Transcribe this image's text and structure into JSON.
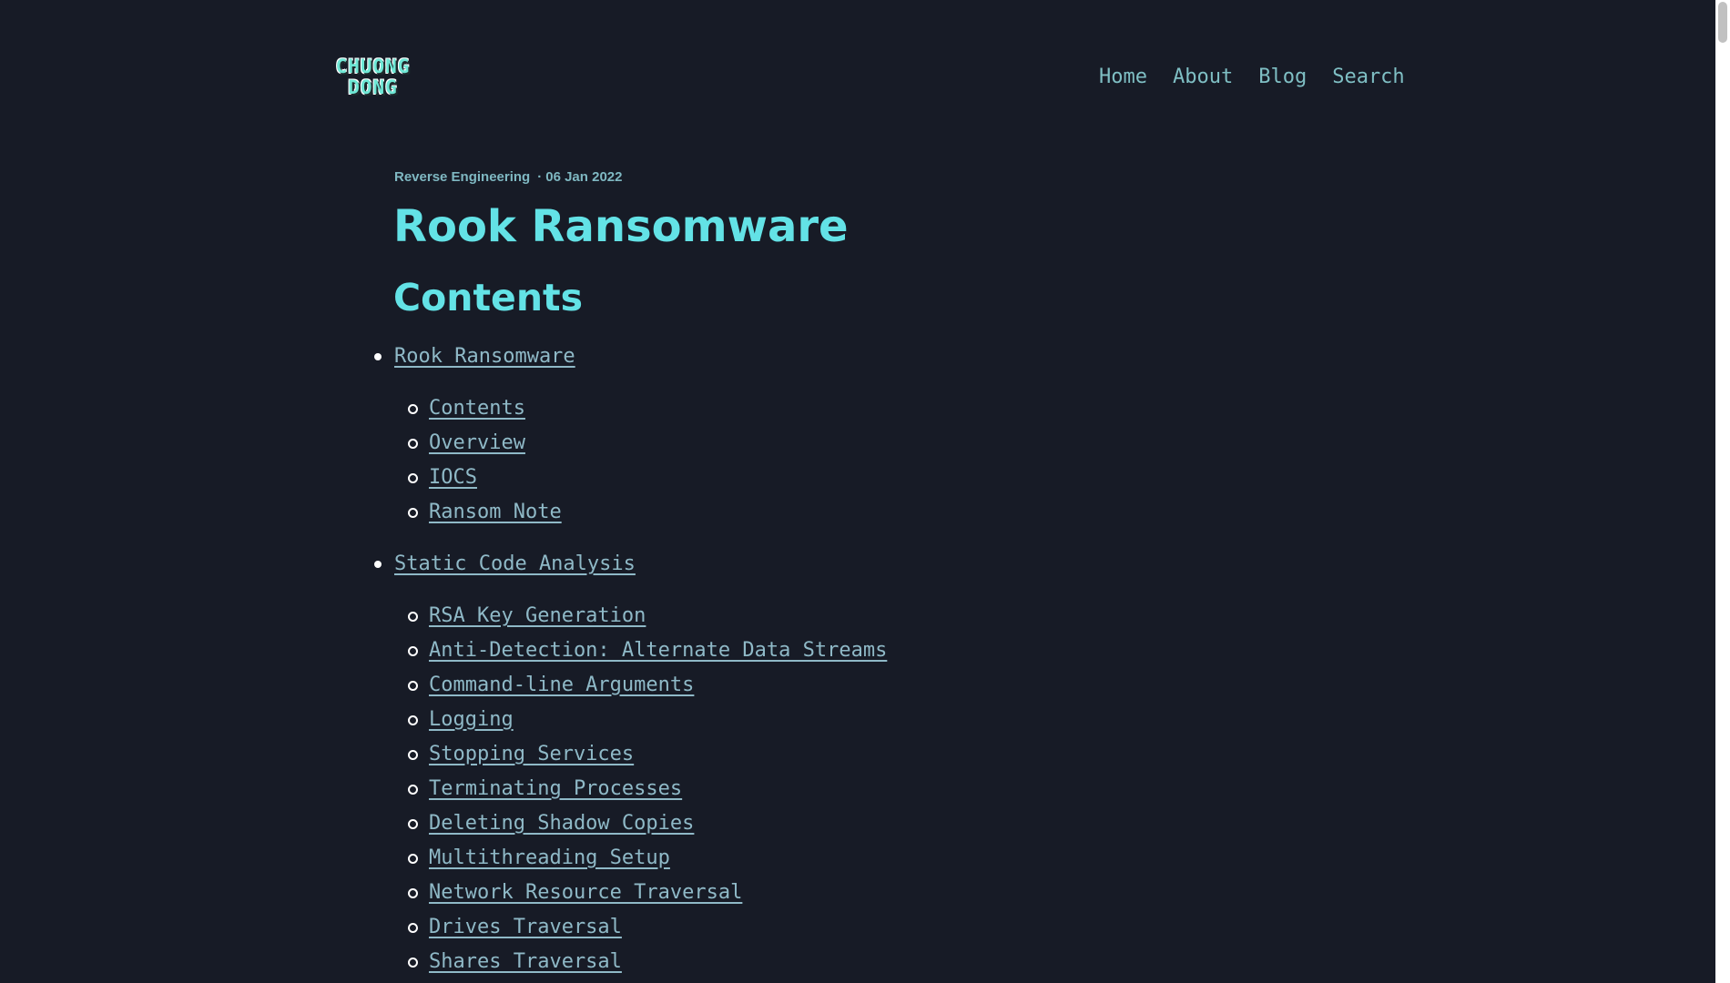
{
  "site": {
    "logo_line1": "CHUONG",
    "logo_line2": "DONG"
  },
  "nav": {
    "home": "Home",
    "about": "About",
    "blog": "Blog",
    "search": "Search"
  },
  "post": {
    "category": "Reverse Engineering",
    "separator": "·",
    "date": "06 Jan 2022",
    "title": "Rook Ransomware",
    "contents_heading": "Contents"
  },
  "toc": {
    "sections": [
      {
        "label": "Rook Ransomware",
        "children": [
          "Contents",
          "Overview",
          "IOCS",
          "Ransom Note"
        ]
      },
      {
        "label": "Static Code Analysis",
        "children": [
          "RSA Key Generation",
          "Anti-Detection: Alternate Data Streams",
          "Command-line Arguments",
          "Logging",
          "Stopping Services",
          "Terminating Processes",
          "Deleting Shadow Copies",
          "Multithreading Setup",
          "Network Resource Traversal",
          "Drives Traversal",
          "Shares Traversal"
        ]
      }
    ]
  }
}
